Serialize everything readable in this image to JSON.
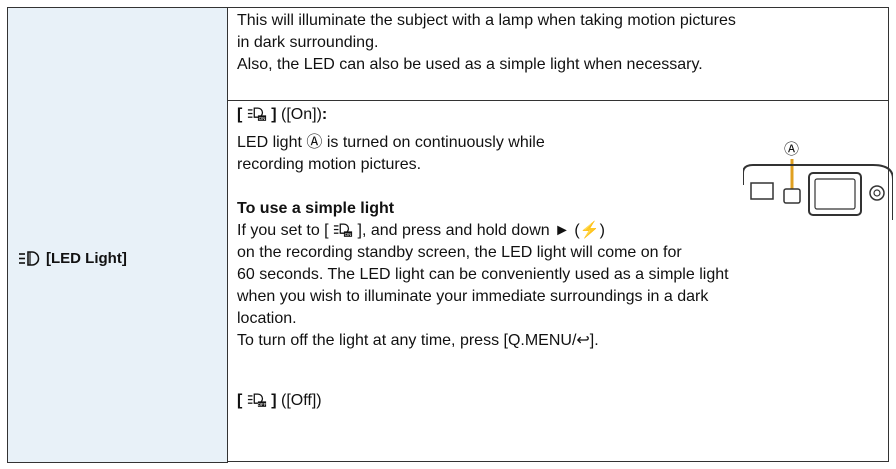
{
  "row": {
    "label": "[LED Light]",
    "label_icon": "led-light-icon"
  },
  "description": {
    "line1": "This will illuminate the subject with a lamp when taking motion pictures",
    "line2": "in dark surrounding.",
    "line3": "Also, the LED can also be used as a simple light when necessary."
  },
  "on_setting": {
    "bracket_open": "[",
    "bracket_close": "]",
    "value": "([On])",
    "colon": ":",
    "icon": "led-on-icon",
    "text_line1": "LED light",
    "callout": "Ⓐ",
    "text_line1_end": "is turned on continuously while",
    "text_line2": "recording motion pictures."
  },
  "figure": {
    "callout": "Ⓐ",
    "icon": "camera-led-diagram"
  },
  "simple_light": {
    "heading": "To use a simple light",
    "line1_a": "If you set to [",
    "line1_b": "], and press and hold down ► (",
    "flash_glyph": "⚡",
    "line1_c": ")",
    "line2": "on the recording standby screen, the LED light will come on for",
    "line3": "60 seconds. The LED light can be conveniently used as a simple light",
    "line4": "when you wish to illuminate your immediate surroundings in a dark",
    "line5": "location.",
    "line6": "To turn off the light at any time, press [Q.MENU/↩]."
  },
  "off_setting": {
    "bracket_open": "[",
    "bracket_close": "]",
    "value": "([Off])",
    "icon": "led-off-icon"
  }
}
